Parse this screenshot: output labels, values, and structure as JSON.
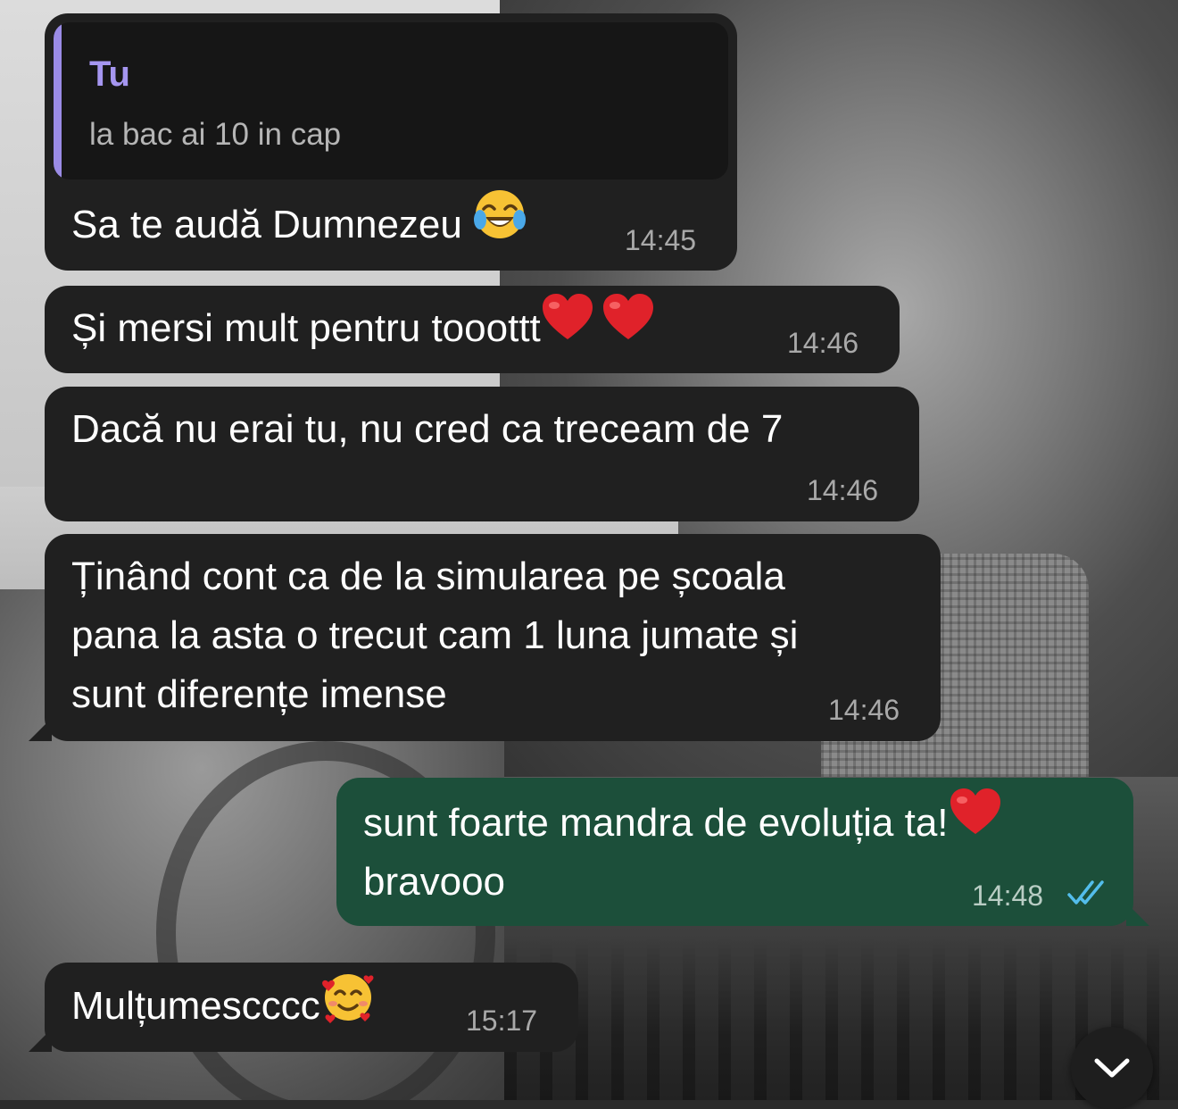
{
  "reply": {
    "author": "Tu",
    "text": "la bac ai 10 in cap"
  },
  "messages": [
    {
      "direction": "in",
      "text": "Sa te audă Dumnezeu ",
      "emoji": [
        "face-with-tears-of-joy"
      ],
      "time": "14:45"
    },
    {
      "direction": "in",
      "text": "Și mersi mult pentru tooottt",
      "emoji": [
        "red-heart",
        "red-heart"
      ],
      "time": "14:46"
    },
    {
      "direction": "in",
      "text": "Dacă nu erai tu, nu cred ca treceam de 7",
      "time": "14:46"
    },
    {
      "direction": "in",
      "lines": [
        "Ținând cont ca de la simularea pe școala",
        "pana la asta o trecut cam 1 luna jumate și",
        "sunt diferențe imense"
      ],
      "time": "14:46"
    },
    {
      "direction": "out",
      "lines": [
        "sunt foarte mandra de evoluția ta!",
        "bravooo"
      ],
      "emoji": [
        "red-heart"
      ],
      "time": "14:48",
      "status": "read"
    },
    {
      "direction": "in",
      "text": "Mulțumescccc",
      "emoji": [
        "smiling-face-with-hearts"
      ],
      "time": "15:17"
    }
  ],
  "scroll_button": {
    "icon": "chevron-down-icon"
  },
  "colors": {
    "incoming_bubble": "#202020",
    "outgoing_bubble": "#1c4f3a",
    "reply_accent": "#9b8ce6",
    "read_ticks": "#53bdeb"
  }
}
